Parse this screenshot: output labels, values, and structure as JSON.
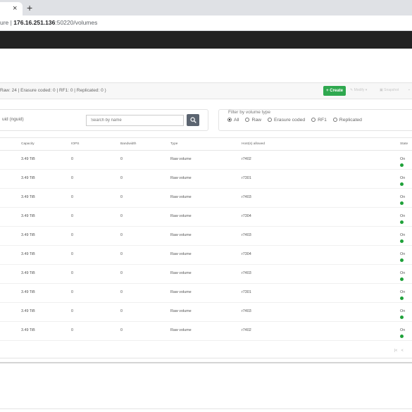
{
  "browser": {
    "tab_close": "×",
    "tab_new": "+",
    "address_prefix": "ure",
    "address_separator": "|",
    "address_host": "176.16.251.136",
    "address_path": ":50220/volumes"
  },
  "toolbar": {
    "summary": "Raw: 24 | Erasure coded: 0 | RF1: 0 | Replicated: 0 )",
    "create_label": "Create",
    "modify_label": "Modify",
    "snapshot_label": "Snapshot"
  },
  "filters": {
    "owner_text": "uid (nguid)",
    "search": {
      "placeholder": "Search by name",
      "value": ""
    },
    "volume_type_title": "Filter by volume type",
    "volume_types": [
      {
        "label": "All",
        "selected": true
      },
      {
        "label": "Raw",
        "selected": false
      },
      {
        "label": "Erasure coded",
        "selected": false
      },
      {
        "label": "RF1",
        "selected": false
      },
      {
        "label": "Replicated",
        "selected": false
      }
    ]
  },
  "table": {
    "columns": [
      "Capacity",
      "IOPS",
      "Bandwidth",
      "Type",
      "Host(s) allowed",
      "State"
    ],
    "rows": [
      [
        "3.49 TiB",
        "0",
        "0",
        "Raw volume",
        "r7402",
        "On"
      ],
      [
        "3.49 TiB",
        "0",
        "0",
        "Raw volume",
        "r7301",
        "On"
      ],
      [
        "3.49 TiB",
        "0",
        "0",
        "Raw volume",
        "r7403",
        "On"
      ],
      [
        "3.49 TiB",
        "0",
        "0",
        "Raw volume",
        "r7304",
        "On"
      ],
      [
        "3.49 TiB",
        "0",
        "0",
        "Raw volume",
        "r7403",
        "On"
      ],
      [
        "3.49 TiB",
        "0",
        "0",
        "Raw volume",
        "r7304",
        "On"
      ],
      [
        "3.49 TiB",
        "0",
        "0",
        "Raw volume",
        "r7403",
        "On"
      ],
      [
        "3.49 TiB",
        "0",
        "0",
        "Raw volume",
        "r7301",
        "On"
      ],
      [
        "3.49 TiB",
        "0",
        "0",
        "Raw volume",
        "r7403",
        "On"
      ],
      [
        "3.49 TiB",
        "0",
        "0",
        "Raw volume",
        "r7402",
        "On"
      ]
    ],
    "status_color": "#1fa13a"
  },
  "pager": {
    "first_label": "|<",
    "prev_label": "<"
  },
  "colors": {
    "create_button": "#2fa84f",
    "app_header": "#222222"
  }
}
